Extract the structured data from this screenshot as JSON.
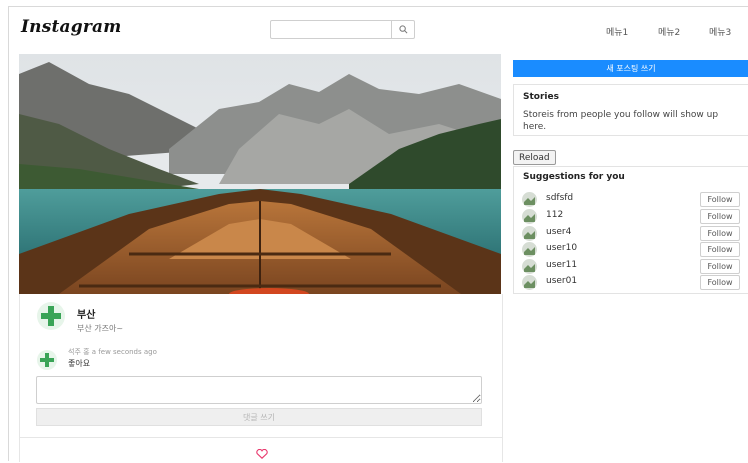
{
  "header": {
    "logo": "Instagram",
    "search": {
      "placeholder": "",
      "value": ""
    },
    "nav": [
      "메뉴1",
      "메뉴2",
      "메뉴3"
    ]
  },
  "post": {
    "title": "부산",
    "caption": "부산 가즈아~",
    "comment": {
      "author": "석주 홍",
      "time": "a few seconds ago",
      "text": "좋아요"
    },
    "comment_input": {
      "value": ""
    },
    "submit_label": "댓글 쓰기"
  },
  "sidebar": {
    "new_post_label": "새 포스팅 쓰기",
    "stories": {
      "title": "Stories",
      "text": "Storeis from people you follow will show up here."
    },
    "reload_label": "Reload",
    "suggestions": {
      "title": "Suggestions for you",
      "follow_label": "Follow",
      "users": [
        "sdfsfd",
        "112",
        "user4",
        "user10",
        "user11",
        "user01"
      ]
    }
  },
  "colors": {
    "accent": "#1a8cff",
    "heart": "#e8386d"
  }
}
